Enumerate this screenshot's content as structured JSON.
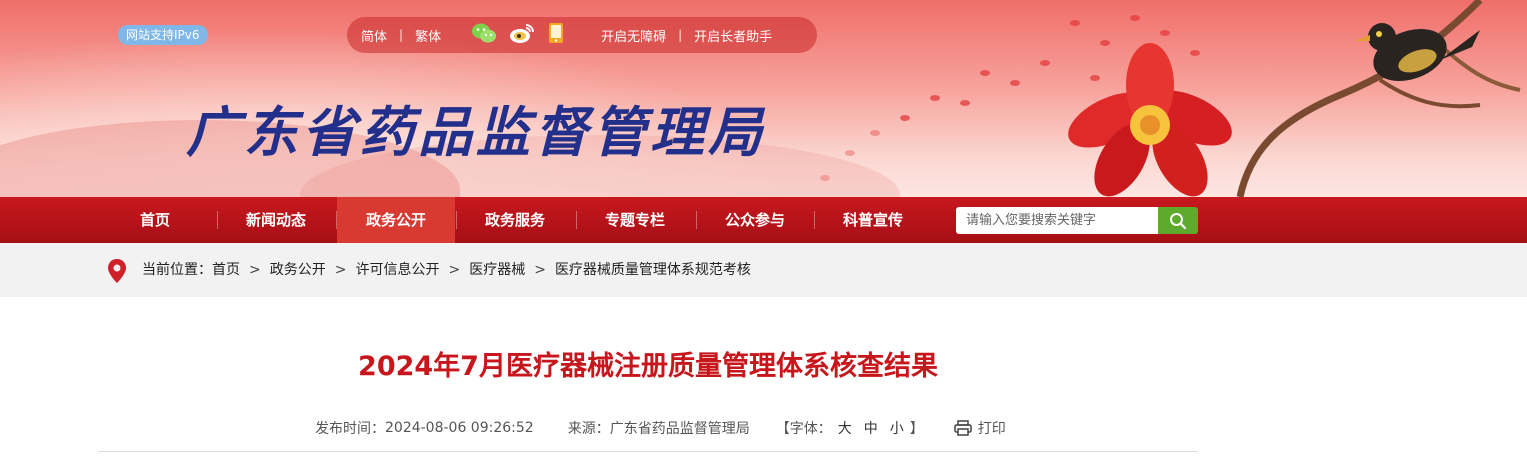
{
  "header": {
    "ipv6_badge": "网站支持IPv6",
    "lang_simplified": "简体",
    "lang_traditional": "繁体",
    "accessibility": "开启无障碍",
    "elder_mode": "开启长者助手",
    "site_title": "广东省药品监督管理局"
  },
  "nav": {
    "items": [
      {
        "label": "首页"
      },
      {
        "label": "新闻动态"
      },
      {
        "label": "政务公开"
      },
      {
        "label": "政务服务"
      },
      {
        "label": "专题专栏"
      },
      {
        "label": "公众参与"
      },
      {
        "label": "科普宣传"
      }
    ],
    "active_index": 2,
    "search_placeholder": "请输入您要搜索关键字"
  },
  "breadcrumb": {
    "prefix": "当前位置：",
    "items": [
      "首页",
      "政务公开",
      "许可信息公开",
      "医疗器械",
      "医疗器械质量管理体系规范考核"
    ],
    "separator": ">"
  },
  "article": {
    "title": "2024年7月医疗器械注册质量管理体系核查结果",
    "publish_label": "发布时间：",
    "publish_time": "2024-08-06 09:26:52",
    "source_label": "来源：",
    "source": "广东省药品监督管理局",
    "font_label_open": "【字体：",
    "font_large": "大",
    "font_medium": "中",
    "font_small": "小",
    "font_label_close": "】",
    "print_label": "打印"
  },
  "colors": {
    "nav_red": "#b3141a",
    "nav_active": "#d83a32",
    "title_red": "#c8161d",
    "site_title_blue": "#23308b",
    "search_green": "#5daa2d"
  },
  "icons": [
    "wechat-icon",
    "weibo-icon",
    "mobile-icon",
    "location-pin-icon",
    "search-icon",
    "print-icon"
  ]
}
